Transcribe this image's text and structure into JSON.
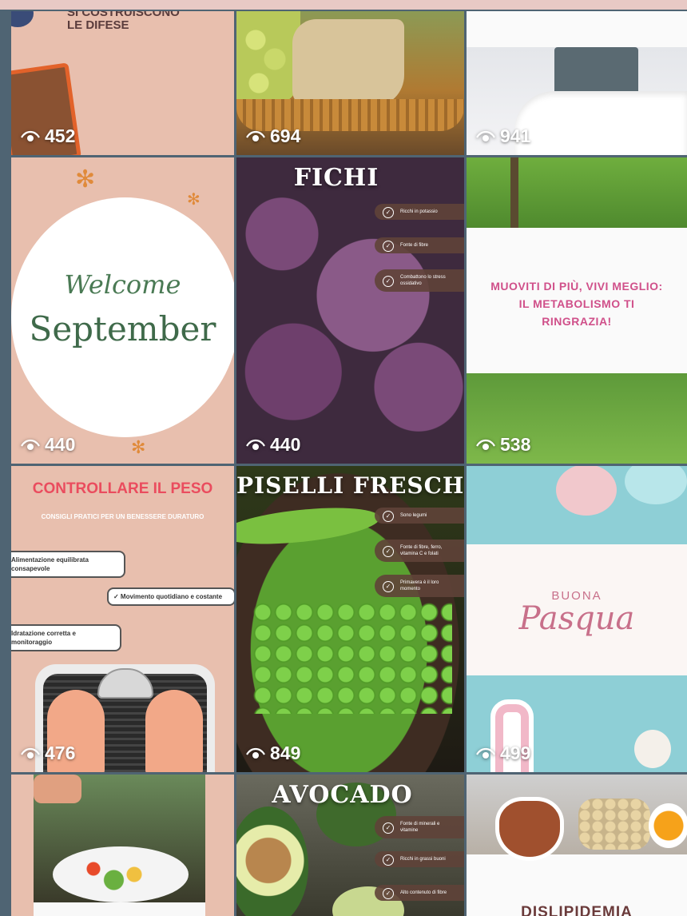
{
  "tiles": [
    {
      "views": "452",
      "text": [
        "SI COSTRUISCONO",
        "LE DIFESE"
      ]
    },
    {
      "views": "694"
    },
    {
      "views": "941"
    },
    {
      "views": "440",
      "text": [
        "Welcome",
        "September"
      ]
    },
    {
      "views": "440",
      "title": "FICHI",
      "bullets": [
        "Ricchi in potassio",
        "Fonte di fibre",
        "Combattono lo stress ossidativo"
      ]
    },
    {
      "views": "538",
      "text": [
        "MUOVITI DI PIÙ, VIVI MEGLIO:",
        "IL METABOLISMO TI",
        "RINGRAZIA!"
      ]
    },
    {
      "views": "476",
      "title": "CONTROLLARE IL PESO",
      "subtitle": "CONSIGLI PRATICI PER UN BENESSERE DURATURO",
      "items": [
        "Alimentazione equilibrata consapevole",
        "✓ Movimento quotidiano e costante",
        "Idratazione corretta e monitoraggio"
      ]
    },
    {
      "views": "849",
      "title": "PISELLI FRESCHI",
      "bullets": [
        "Sono legumi",
        "Fonte di fibre, ferro, vitamina C e folati",
        "Primavera è il loro momento"
      ]
    },
    {
      "views": "499",
      "text": [
        "BUONA",
        "Pasqua"
      ]
    },
    {
      "views": ""
    },
    {
      "views": "",
      "title": "AVOCADO",
      "bullets": [
        "Fonte di minerali e vitamine",
        "Ricchi in grassi buoni",
        "Alto contenuto di fibre"
      ]
    },
    {
      "views": "",
      "text": [
        "DISLIPIDEMIA"
      ]
    }
  ],
  "icons": {
    "views": "eye-icon",
    "check": "check-circle-icon"
  },
  "colors": {
    "background": "#4f6473",
    "peach": "#e8bfae",
    "pink_title": "#ea4c5e",
    "pasqua": "#c8708a",
    "green_text": "#3f6a4a"
  }
}
